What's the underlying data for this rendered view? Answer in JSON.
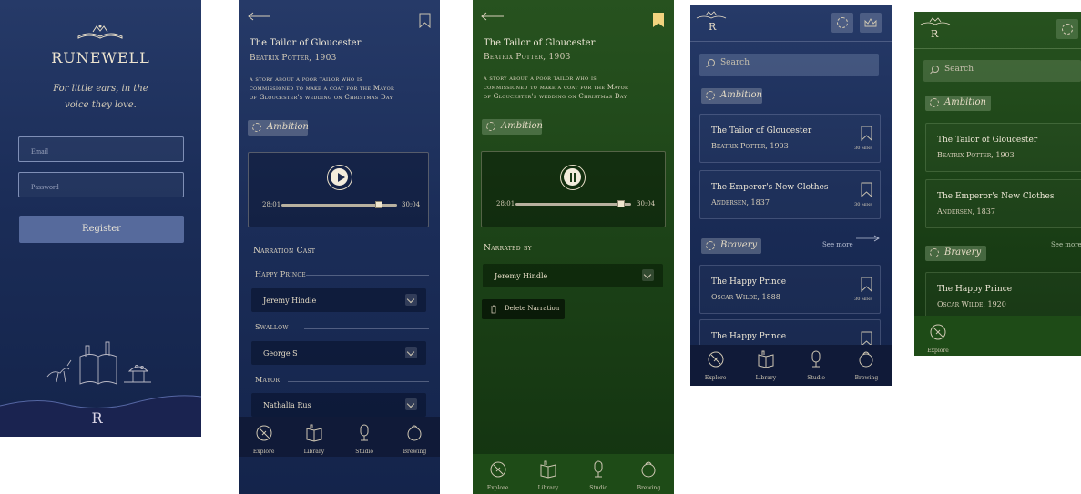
{
  "colors": {
    "blue_bg": "#1b2d58",
    "green_bg": "#1c4217",
    "cream": "#e9e1cf",
    "gold_bookmark": "#f2d37f",
    "register_button": "#566a9c"
  },
  "login": {
    "brand": "RUNEWELL",
    "tagline_line1": "For little ears, in the",
    "tagline_line2": "voice they love.",
    "email_placeholder": "Email",
    "password_placeholder": "Password",
    "register_label": "Register",
    "monogram": "R"
  },
  "detail": {
    "title": "The Tailor of Gloucester",
    "author": "Beatrix Potter, 1903",
    "synopsis_line1": "a story about a poor tailor who is",
    "synopsis_line2": "commissioned to make a coat for the Mayor",
    "synopsis_line3": "of Gloucester's wedding on Christmas Day",
    "tag": "Ambition",
    "player": {
      "current_time": "28:01",
      "total_time": "30:04",
      "progress": 0.86
    },
    "cast_heading": "Narration Cast",
    "cast": [
      {
        "role": "Happy Prince",
        "narrator": "Jeremy Hindle"
      },
      {
        "role": "Swallow",
        "narrator": "George S"
      },
      {
        "role": "Mayor",
        "narrator": "Nathalia Rus"
      }
    ]
  },
  "detail_green": {
    "title": "The Tailor of Gloucester",
    "author": "Beatrix Potter, 1903",
    "synopsis_line1": "a story about a poor tailor who is",
    "synopsis_line2": "commissioned to make a coat for the Mayor",
    "synopsis_line3": "of Gloucester's wedding on Christmas Day",
    "tag": "Ambition",
    "player": {
      "current_time": "28:01",
      "total_time": "30:04",
      "progress": 0.86
    },
    "narrated_by_label": "Narrated by",
    "narrator": "Jeremy Hindle",
    "delete_label": "Delete Narration"
  },
  "nav": {
    "explore": "Explore",
    "library": "Library",
    "studio": "Studio",
    "brewing": "Brewing"
  },
  "explore": {
    "monogram": "R",
    "search_placeholder": "Search",
    "section_ambition": "Ambition",
    "section_bravery": "Bravery",
    "see_more": "See more",
    "cards": [
      {
        "title": "The Tailor of Gloucester",
        "author": "Beatrix Potter, 1903",
        "duration": "30 mins"
      },
      {
        "title": "The Emperor's New Clothes",
        "author": "Andersen, 1837",
        "duration": "30 mins"
      },
      {
        "title": "The Happy Prince",
        "author": "Oscar Wilde, 1888",
        "duration": "30 mins"
      },
      {
        "title": "The Happy Prince",
        "author": "",
        "duration": ""
      }
    ]
  },
  "explore_green": {
    "monogram": "R",
    "search_placeholder": "Search",
    "section_ambition": "Ambition",
    "section_bravery": "Bravery",
    "see_more": "See more",
    "cards": [
      {
        "title": "The Tailor of Gloucester",
        "author": "Beatrix Potter, 1903"
      },
      {
        "title": "The Emperor's New Clothes",
        "author": "Andersen, 1837"
      },
      {
        "title": "The Happy Prince",
        "author": "Oscar Wilde, 1920"
      }
    ]
  }
}
